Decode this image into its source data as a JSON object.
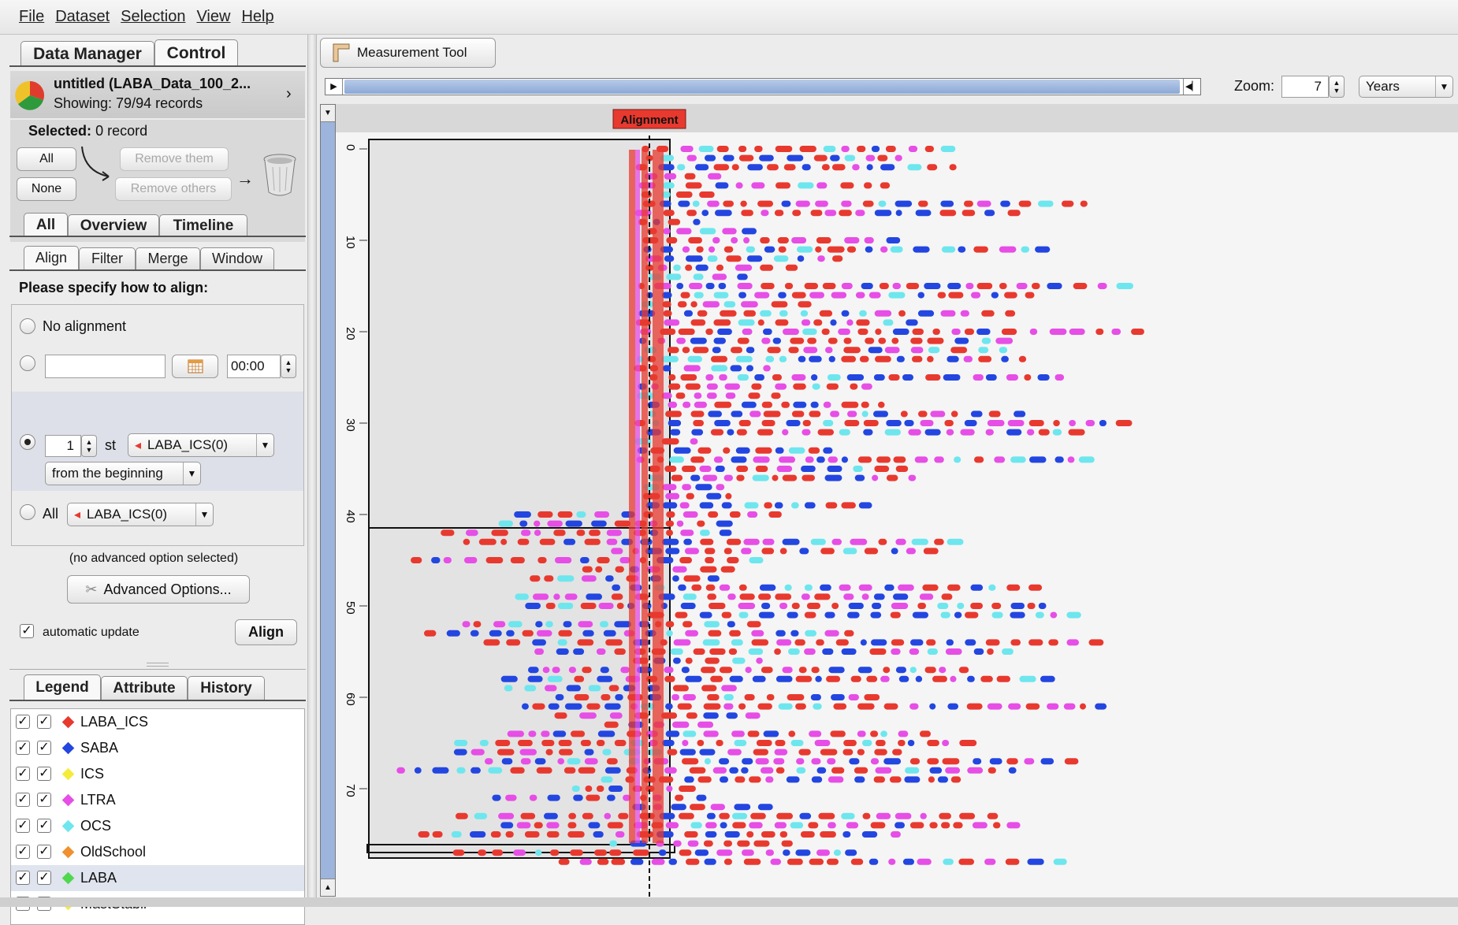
{
  "menu": [
    "File",
    "Dataset",
    "Selection",
    "View",
    "Help"
  ],
  "top_tabs": [
    "Data Manager",
    "Control"
  ],
  "dataset": {
    "title": "untitled (LABA_Data_100_2...",
    "showing": "Showing: 79/94 records"
  },
  "selection": {
    "label": "Selected:",
    "value": "0 record",
    "all": "All",
    "none": "None",
    "remove_them": "Remove them",
    "remove_others": "Remove others"
  },
  "view_tabs": [
    "All",
    "Overview",
    "Timeline"
  ],
  "op_tabs": [
    "Align",
    "Filter",
    "Merge",
    "Window"
  ],
  "align": {
    "heading": "Please specify how to align:",
    "no_alignment": "No alignment",
    "time_value": "00:00",
    "nth_value": "1",
    "nth_suffix": "st",
    "event_combo": "LABA_ICS(0)",
    "from_combo": "from the beginning",
    "all_label": "All",
    "all_combo": "LABA_ICS(0)",
    "advanced_note": "(no advanced option selected)",
    "advanced_button": "Advanced Options...",
    "auto_update": "automatic update",
    "align_button": "Align"
  },
  "bottom_tabs": [
    "Legend",
    "Attribute",
    "History"
  ],
  "legend": [
    {
      "name": "LABA_ICS",
      "color": "#e8392f"
    },
    {
      "name": "SABA",
      "color": "#2346e0"
    },
    {
      "name": "ICS",
      "color": "#f5ec3a"
    },
    {
      "name": "LTRA",
      "color": "#e64ee6"
    },
    {
      "name": "OCS",
      "color": "#6ee6ee"
    },
    {
      "name": "OldSchool",
      "color": "#f0902f"
    },
    {
      "name": "LABA",
      "color": "#4fd84f"
    },
    {
      "name": "MastStabil",
      "color": "#f5ec3a"
    }
  ],
  "toolbar": {
    "measurement": "Measurement Tool",
    "zoom_label": "Zoom:",
    "zoom_value": "7",
    "unit": "Years"
  },
  "timeline": {
    "alignment_label": "Alignment",
    "row_ticks": [
      "0",
      "10",
      "20",
      "30",
      "40",
      "50",
      "60",
      "70"
    ],
    "colors": {
      "laba_ics": "#e8392f",
      "saba": "#2346e0",
      "ltra": "#e64ee6",
      "ocs": "#6ee6ee",
      "ics": "#f5ec3a"
    }
  }
}
